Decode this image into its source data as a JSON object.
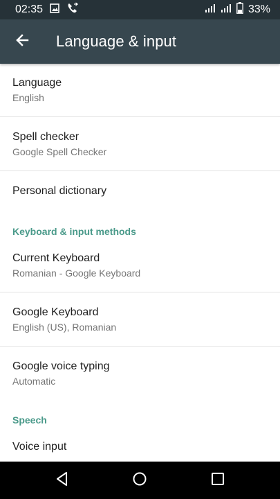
{
  "status_bar": {
    "time": "02:35",
    "battery": "33%",
    "icons": [
      "image-icon",
      "phone-icon",
      "signal-icon",
      "signal-icon",
      "battery-icon"
    ]
  },
  "app_bar": {
    "title": "Language & input",
    "back_icon": "back-arrow-icon"
  },
  "prefs": [
    {
      "title": "Language",
      "summary": "English"
    },
    {
      "title": "Spell checker",
      "summary": "Google Spell Checker"
    },
    {
      "title": "Personal dictionary"
    }
  ],
  "keyboard_section": {
    "header": "Keyboard & input methods",
    "items": [
      {
        "title": "Current Keyboard",
        "summary": "Romanian - Google Keyboard"
      },
      {
        "title": "Google Keyboard",
        "summary": "English (US), Romanian"
      },
      {
        "title": "Google voice typing",
        "summary": "Automatic"
      }
    ]
  },
  "speech_section": {
    "header": "Speech",
    "items": [
      {
        "title": "Voice input"
      }
    ]
  },
  "nav_bar": {
    "icons": [
      "back-triangle-icon",
      "home-circle-icon",
      "recents-square-icon"
    ]
  },
  "colors": {
    "status_bar": "#263238",
    "app_bar": "#37474f",
    "accent": "#4a9a8a"
  }
}
